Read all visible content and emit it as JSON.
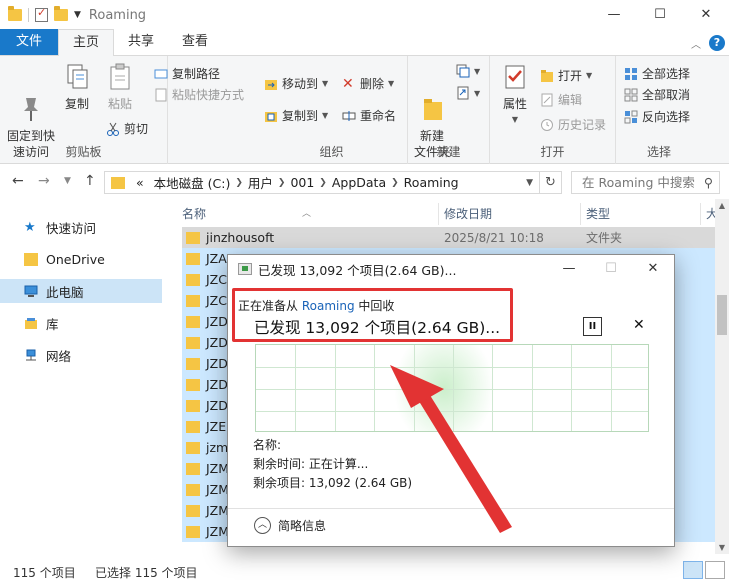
{
  "window": {
    "title": "Roaming",
    "minimize_glyph": "—",
    "maximize_glyph": "☐",
    "close_glyph": "✕"
  },
  "ribbon_tabs": [
    "文件",
    "主页",
    "共享",
    "查看"
  ],
  "ribbon": {
    "clipboard": {
      "label": "剪贴板",
      "pin": "固定到快\n速访问",
      "copy": "复制",
      "paste": "粘贴",
      "copy_path": "复制路径",
      "paste_shortcut": "粘贴快捷方式",
      "cut": "剪切"
    },
    "organize": {
      "label": "组织",
      "move_to": "移动到",
      "copy_to": "复制到",
      "delete": "删除",
      "rename": "重命名"
    },
    "new": {
      "label": "新建",
      "new_folder": "新建\n文件夹"
    },
    "open": {
      "label": "打开",
      "properties": "属性",
      "open": "打开",
      "edit": "编辑",
      "history": "历史记录"
    },
    "select": {
      "label": "选择",
      "select_all": "全部选择",
      "select_none": "全部取消",
      "invert": "反向选择"
    }
  },
  "address": {
    "prefix": "«",
    "crumbs": [
      "本地磁盘 (C:)",
      "用户",
      "001",
      "AppData",
      "Roaming"
    ],
    "search_placeholder": "在 Roaming 中搜索"
  },
  "nav": [
    {
      "label": "快速访问",
      "icon": "star-icon"
    },
    {
      "label": "OneDrive",
      "icon": "cloud-folder-icon"
    },
    {
      "label": "此电脑",
      "icon": "computer-icon"
    },
    {
      "label": "库",
      "icon": "library-icon"
    },
    {
      "label": "网络",
      "icon": "network-icon"
    }
  ],
  "columns": {
    "name": "名称",
    "date": "修改日期",
    "type": "类型",
    "size": "大"
  },
  "files": [
    {
      "name": "jinzhousoft",
      "date": "2025/8/21 10:18",
      "type": "文件夹"
    },
    {
      "name": "JZAI",
      "date": "",
      "type": ""
    },
    {
      "name": "JZCI",
      "date": "",
      "type": ""
    },
    {
      "name": "JZCI",
      "date": "",
      "type": ""
    },
    {
      "name": "JZDI",
      "date": "",
      "type": ""
    },
    {
      "name": "JZDI",
      "date": "",
      "type": ""
    },
    {
      "name": "JZDI",
      "date": "",
      "type": ""
    },
    {
      "name": "JZDI",
      "date": "",
      "type": ""
    },
    {
      "name": "JZD(",
      "date": "",
      "type": ""
    },
    {
      "name": "JZEL",
      "date": "",
      "type": ""
    },
    {
      "name": "jzmi",
      "date": "",
      "type": ""
    },
    {
      "name": "JZMI",
      "date": "",
      "type": ""
    },
    {
      "name": "JZM",
      "date": "",
      "type": ""
    },
    {
      "name": "JZM",
      "date": "",
      "type": ""
    },
    {
      "name": "JZM",
      "date": "",
      "type": ""
    }
  ],
  "status": {
    "count": "115 个项目",
    "selected": "已选择 115 个项目"
  },
  "dialog": {
    "title": "已发现 13,092 个项目(2.64 GB)...",
    "preparing_prefix": "正在准备从 ",
    "preparing_source": "Roaming",
    "preparing_suffix": " 中回收",
    "main_text": "已发现 13,092 个项目(2.64 GB)...",
    "pause_glyph": "II",
    "stop_glyph": "✕",
    "name_label": "名称:",
    "time_remaining": "剩余时间: 正在计算...",
    "items_remaining": "剩余项目: 13,092 (2.64 GB)",
    "less_details": "简略信息",
    "minimize_glyph": "—",
    "maximize_glyph": "☐",
    "close_glyph": "✕"
  },
  "colors": {
    "accent": "#1979ca",
    "annotation_red": "#e23333",
    "folder": "#f5c544",
    "graph_green": "#a8e0a8"
  }
}
